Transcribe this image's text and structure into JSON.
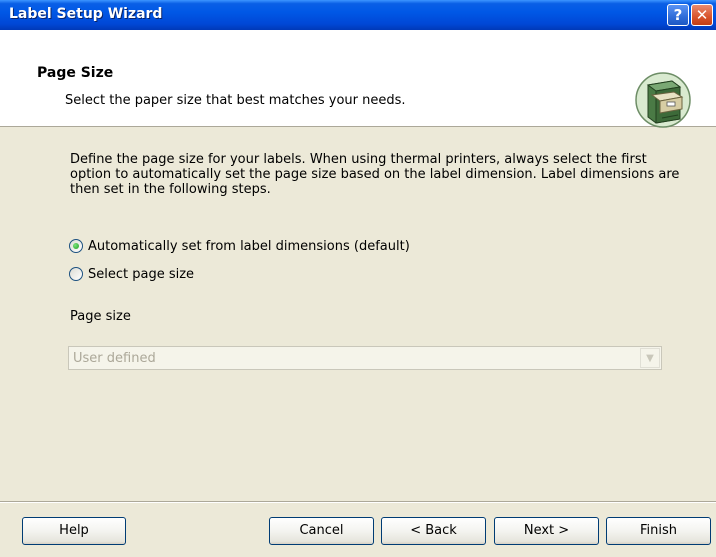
{
  "window": {
    "title": "Label Setup Wizard",
    "help_button": "?",
    "close_button": "✕"
  },
  "header": {
    "title": "Page Size",
    "subtitle": "Select the paper size that best matches your needs.",
    "icon": "file-cabinet-icon"
  },
  "body": {
    "description": "Define the page size for your labels. When using thermal printers, always select the first option to automatically set the page size based on the label dimension. Label dimensions are then set in the following steps.",
    "options": [
      {
        "label": "Automatically set from label dimensions (default)",
        "checked": true
      },
      {
        "label": "Select page size",
        "checked": false
      }
    ],
    "page_size_label": "Page size",
    "page_size_value": "User defined",
    "page_size_enabled": false
  },
  "footer": {
    "help": "Help",
    "cancel": "Cancel",
    "back": "< Back",
    "next": "Next >",
    "finish": "Finish"
  }
}
